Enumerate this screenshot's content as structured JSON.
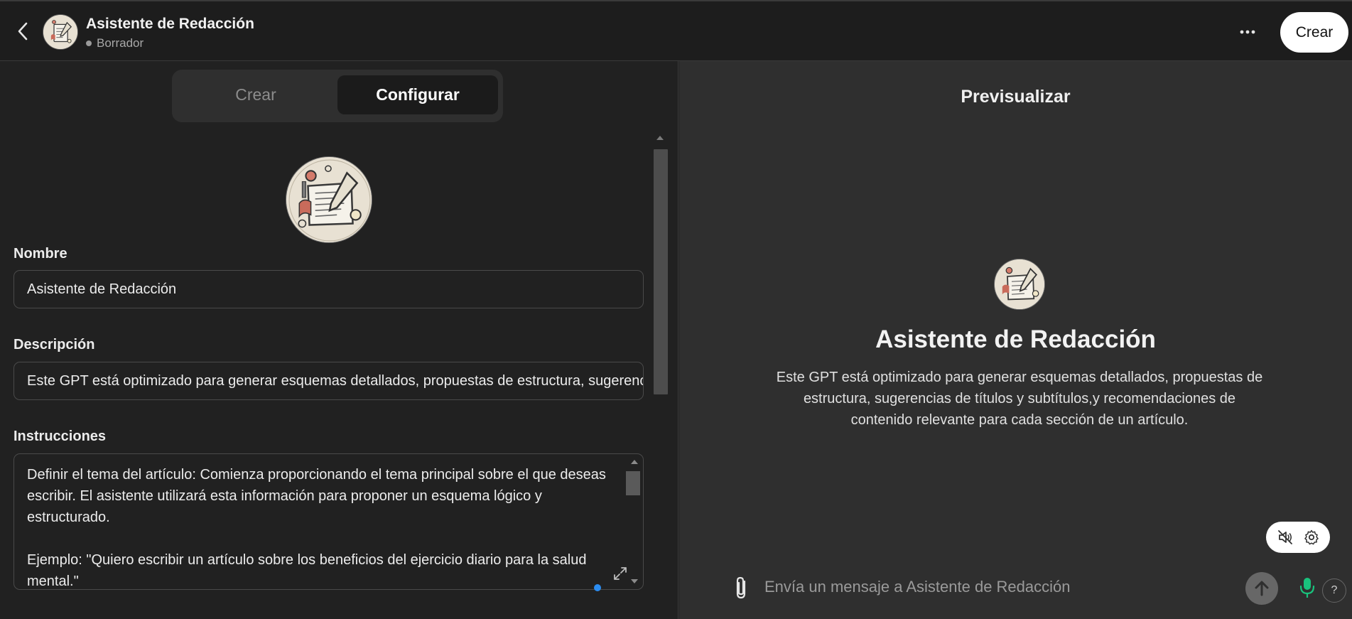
{
  "header": {
    "title": "Asistente de Redacción",
    "status": "Borrador",
    "more_label": "···",
    "create_label": "Crear",
    "icons": {
      "back": "chevron-left-icon",
      "more": "ellipsis-icon",
      "avatar": "writing-assistant-avatar"
    }
  },
  "tabs": [
    {
      "label": "Crear",
      "active": false
    },
    {
      "label": "Configurar",
      "active": true
    }
  ],
  "form": {
    "name_label": "Nombre",
    "name_value": "Asistente de Redacción",
    "description_label": "Descripción",
    "description_value": "Este GPT está optimizado para generar esquemas detallados, propuestas de estructura, sugerencias de títulos y subtítulos,y recomendaciones de contenido relevante para cada sección de un artículo.",
    "instructions_label": "Instrucciones",
    "instructions_value": "Definir el tema del artículo: Comienza proporcionando el tema principal sobre el que deseas escribir. El asistente utilizará esta información para proponer un esquema lógico y estructurado.\n\nEjemplo: \"Quiero escribir un artículo sobre los beneficios del ejercicio diario para la salud mental.\""
  },
  "preview": {
    "title": "Previsualizar",
    "name": "Asistente de Redacción",
    "description": "Este GPT está optimizado para generar esquemas detallados, propuestas de estructura, sugerencias de títulos y subtítulos,y recomendaciones de contenido relevante para cada sección de un artículo.",
    "message_placeholder": "Envía un mensaje a Asistente de Redacción",
    "help_label": "?",
    "icons": {
      "attach": "paperclip-icon",
      "send": "arrow-up-icon",
      "mic": "microphone-icon",
      "mute": "speaker-muted-icon",
      "settings": "gear-icon"
    }
  },
  "colors": {
    "background": "#212121",
    "preview_background": "#2f2f2f",
    "accent_mic": "#19c37d",
    "focus_dot": "#2b8cf0"
  }
}
